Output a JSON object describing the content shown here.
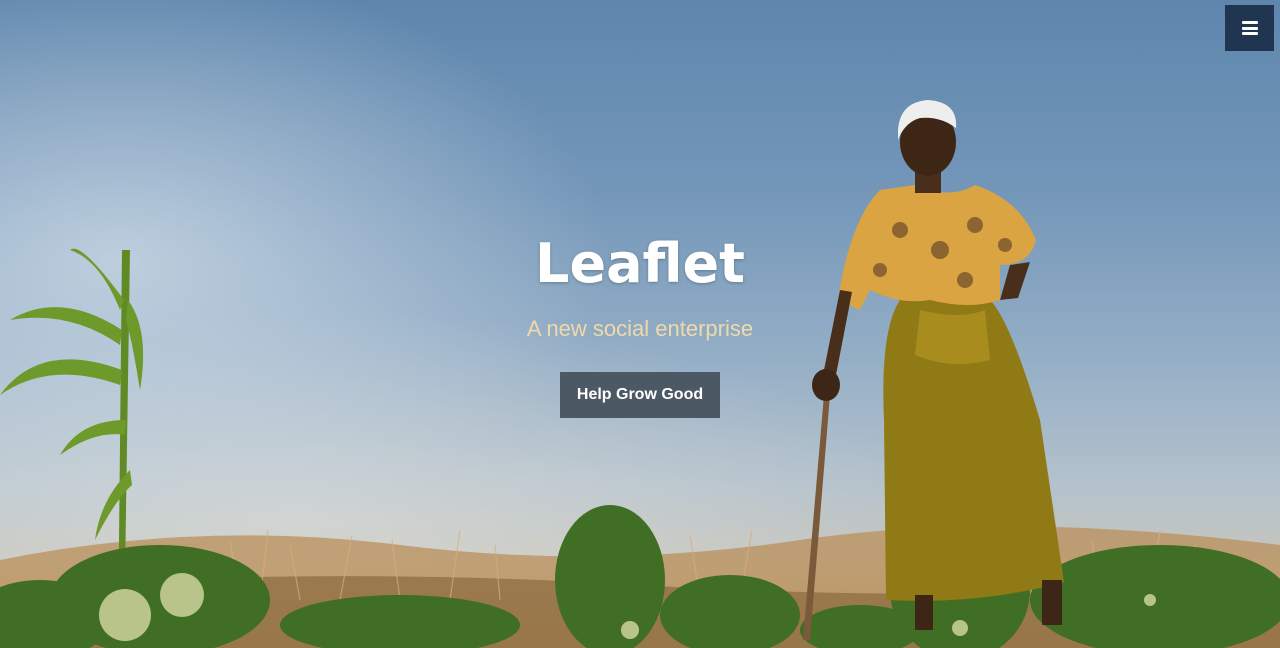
{
  "hero": {
    "title": "Leaflet",
    "subtitle": "A new social enterprise",
    "cta_label": "Help Grow Good"
  },
  "nav": {
    "menu_icon": "hamburger-icon"
  },
  "colors": {
    "menu_button_bg": "#1f3550",
    "cta_bg": "#4c5864",
    "subtitle": "#f0d9a8",
    "sky_top": "#5e86ad"
  }
}
